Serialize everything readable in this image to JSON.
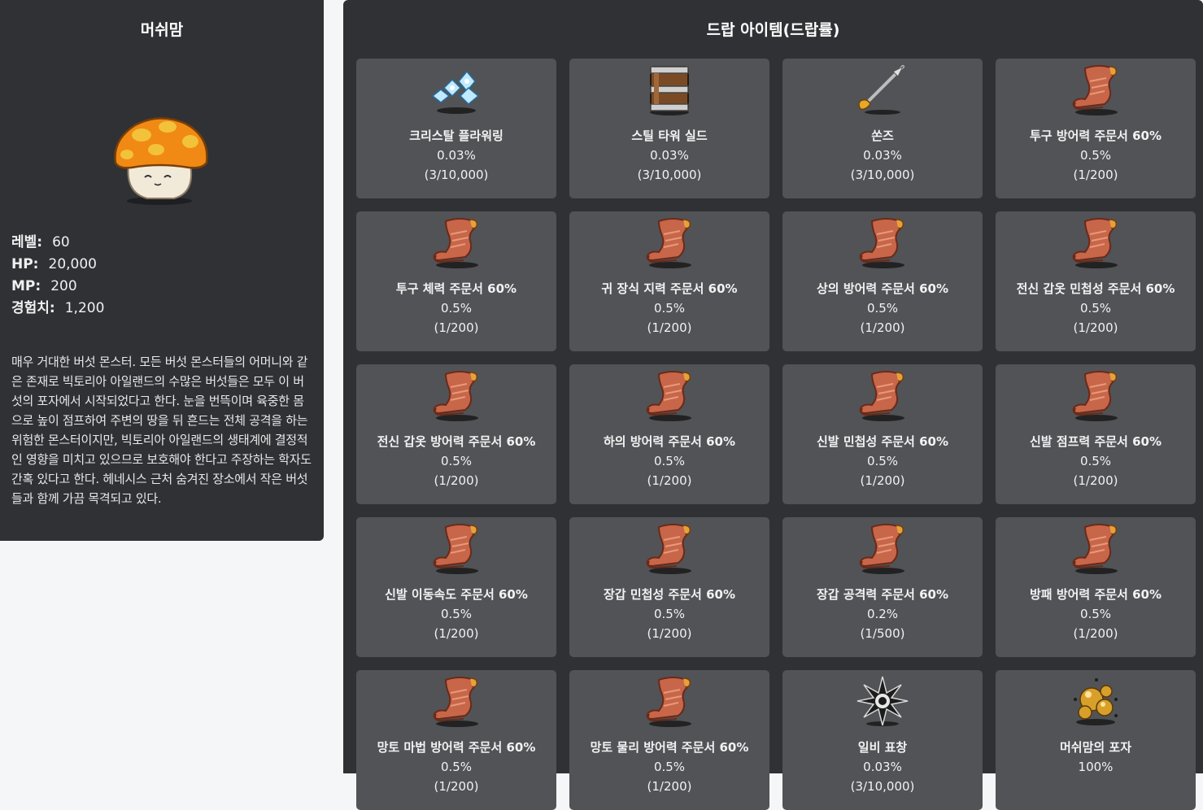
{
  "monster": {
    "name": "머쉬맘",
    "stats": [
      {
        "label": "레벨:",
        "value": "60"
      },
      {
        "label": "HP:",
        "value": "20,000"
      },
      {
        "label": "MP:",
        "value": "200"
      },
      {
        "label": "경험치:",
        "value": "1,200"
      }
    ],
    "description": "매우 거대한 버섯 몬스터. 모든 버섯 몬스터들의 어머니와 같은 존재로 빅토리아 아일랜드의 수많은 버섯들은 모두 이 버섯의 포자에서 시작되었다고 한다. 눈을 번뜩이며 육중한 몸으로 높이 점프하여 주변의 땅을 뒤 흔드는 전체 공격을 하는 위험한 몬스터이지만, 빅토리아 아일랜드의 생태계에 결정적인 영향을 미치고 있으므로 보호해야 한다고 주장하는 학자도 간혹 있다고 한다. 헤네시스 근처 숨겨진 장소에서 작은 버섯들과 함께 가끔 목격되고 있다."
  },
  "drops": {
    "title": "드랍 아이템(드랍률)",
    "items": [
      {
        "name": "크리스탈 플라워링",
        "rate": "0.03%",
        "fraction": "(3/10,000)",
        "icon": "crystal"
      },
      {
        "name": "스틸 타워 실드",
        "rate": "0.03%",
        "fraction": "(3/10,000)",
        "icon": "shield"
      },
      {
        "name": "쏜즈",
        "rate": "0.03%",
        "fraction": "(3/10,000)",
        "icon": "spear"
      },
      {
        "name": "투구 방어력 주문서 60%",
        "rate": "0.5%",
        "fraction": "(1/200)",
        "icon": "scroll"
      },
      {
        "name": "투구 체력 주문서 60%",
        "rate": "0.5%",
        "fraction": "(1/200)",
        "icon": "scroll"
      },
      {
        "name": "귀 장식 지력 주문서 60%",
        "rate": "0.5%",
        "fraction": "(1/200)",
        "icon": "scroll"
      },
      {
        "name": "상의 방어력 주문서 60%",
        "rate": "0.5%",
        "fraction": "(1/200)",
        "icon": "scroll"
      },
      {
        "name": "전신 갑옷 민첩성 주문서 60%",
        "rate": "0.5%",
        "fraction": "(1/200)",
        "icon": "scroll"
      },
      {
        "name": "전신 갑옷 방어력 주문서 60%",
        "rate": "0.5%",
        "fraction": "(1/200)",
        "icon": "scroll"
      },
      {
        "name": "하의 방어력 주문서 60%",
        "rate": "0.5%",
        "fraction": "(1/200)",
        "icon": "scroll"
      },
      {
        "name": "신발 민첩성 주문서 60%",
        "rate": "0.5%",
        "fraction": "(1/200)",
        "icon": "scroll"
      },
      {
        "name": "신발 점프력 주문서 60%",
        "rate": "0.5%",
        "fraction": "(1/200)",
        "icon": "scroll"
      },
      {
        "name": "신발 이동속도 주문서 60%",
        "rate": "0.5%",
        "fraction": "(1/200)",
        "icon": "scroll"
      },
      {
        "name": "장갑 민첩성 주문서 60%",
        "rate": "0.5%",
        "fraction": "(1/200)",
        "icon": "scroll"
      },
      {
        "name": "장갑 공격력 주문서 60%",
        "rate": "0.2%",
        "fraction": "(1/500)",
        "icon": "scroll"
      },
      {
        "name": "방패 방어력 주문서 60%",
        "rate": "0.5%",
        "fraction": "(1/200)",
        "icon": "scroll"
      },
      {
        "name": "망토 마법 방어력 주문서 60%",
        "rate": "0.5%",
        "fraction": "(1/200)",
        "icon": "scroll"
      },
      {
        "name": "망토 물리 방어력 주문서 60%",
        "rate": "0.5%",
        "fraction": "(1/200)",
        "icon": "scroll"
      },
      {
        "name": "일비 표창",
        "rate": "0.03%",
        "fraction": "(3/10,000)",
        "icon": "star"
      },
      {
        "name": "머쉬맘의 포자",
        "rate": "100%",
        "fraction": "",
        "icon": "spores"
      }
    ]
  }
}
